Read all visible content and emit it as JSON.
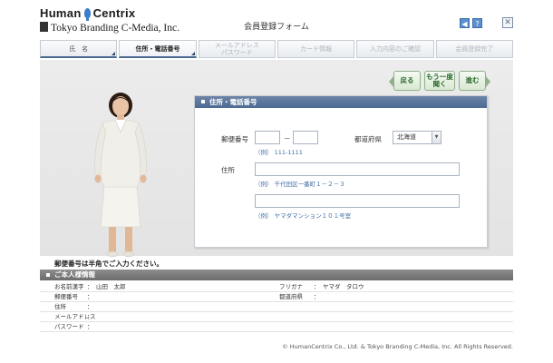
{
  "header": {
    "logo_top_left": "Human",
    "logo_top_right": "Centrix",
    "logo_bottom": "Tokyo Branding C-Media, Inc.",
    "title": "会員登録フォーム",
    "icons": [
      "speaker-icon",
      "help-icon",
      "close-icon"
    ],
    "help_glyph": "?",
    "speaker_glyph": "◀",
    "close_glyph": "✕"
  },
  "steps": [
    {
      "label": "氏　名",
      "state": "done"
    },
    {
      "label": "住所・電話番号",
      "state": "active"
    },
    {
      "label": "メールアドレス\nパスワード",
      "state": "inactive"
    },
    {
      "label": "カード情報",
      "state": "inactive"
    },
    {
      "label": "入力内容のご確認",
      "state": "inactive"
    },
    {
      "label": "会員登録完了",
      "state": "inactive"
    }
  ],
  "buttons": {
    "back": "戻る",
    "retry": "もう一度\n聞く",
    "next": "進む"
  },
  "panel": {
    "title": "住所・電話番号",
    "postal_label": "郵便番号",
    "postal_dash": "－",
    "postal_hint": "（例） 111-1111",
    "pref_label": "都道府県",
    "pref_value": "北海道",
    "address_label": "住所",
    "address1_hint": "（例） 千代田区一番町１－２－３",
    "address2_hint": "（例） ヤマダマンション１０１号室"
  },
  "message": "郵便番号は半角でご入力ください。",
  "info": {
    "title": "ご本人様情報",
    "rows": [
      {
        "label": "お名前漢字",
        "value": "山田　太郎",
        "label2": "フリガナ",
        "value2": "ヤマダ　タロウ"
      },
      {
        "label": "郵便番号",
        "value": "",
        "label2": "都道府県",
        "value2": ""
      },
      {
        "label": "住所",
        "value": "",
        "label2": "",
        "value2": ""
      },
      {
        "label": "メールアドレス",
        "value": "",
        "label2": "",
        "value2": ""
      },
      {
        "label": "パスワード",
        "value": "",
        "label2": "",
        "value2": ""
      }
    ],
    "colon": "："
  },
  "footer": "© HumanCentrix Co., Ltd. & Tokyo Branding C-Media, Inc. All Rights Reserved.",
  "colors": {
    "panel_header": "#5a7499",
    "nav_green": "#2d6a2e",
    "hint_blue": "#3f6ea6"
  }
}
